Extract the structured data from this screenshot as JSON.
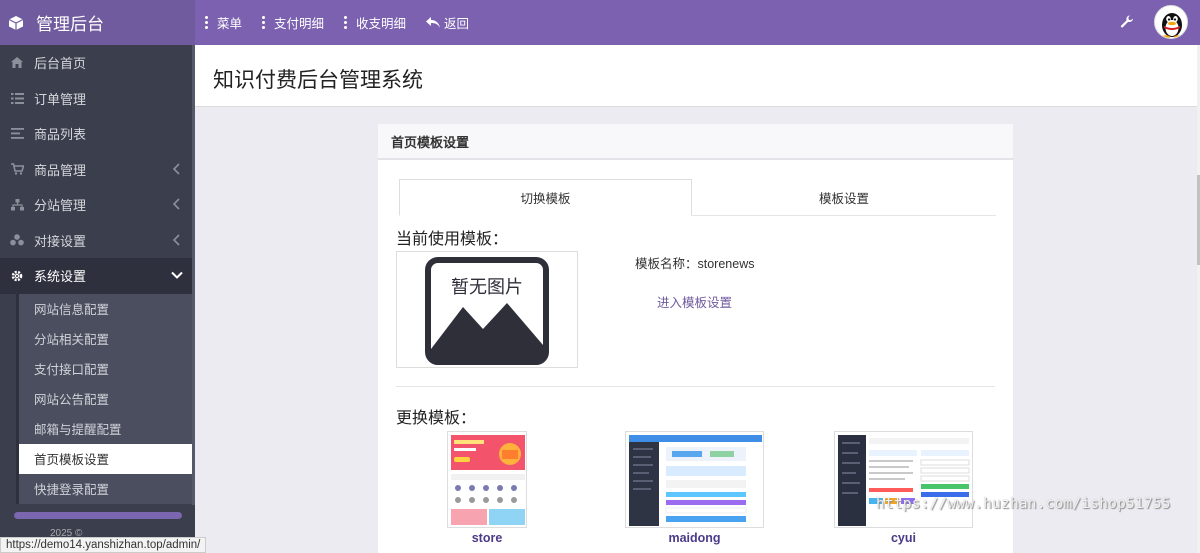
{
  "brand": {
    "title": "管理后台"
  },
  "sidebar": {
    "items": [
      {
        "label": "后台首页",
        "icon": "home-icon"
      },
      {
        "label": "订单管理",
        "icon": "list-icon"
      },
      {
        "label": "商品列表",
        "icon": "lines-icon"
      },
      {
        "label": "商品管理",
        "icon": "cart-icon"
      },
      {
        "label": "分站管理",
        "icon": "sitemap-icon"
      },
      {
        "label": "对接设置",
        "icon": "cubes-icon"
      },
      {
        "label": "系统设置",
        "icon": "gear-icon"
      }
    ],
    "sub_items": [
      {
        "label": "网站信息配置"
      },
      {
        "label": "分站相关配置"
      },
      {
        "label": "支付接口配置"
      },
      {
        "label": "网站公告配置"
      },
      {
        "label": "邮箱与提醒配置"
      },
      {
        "label": "首页模板设置"
      },
      {
        "label": "快捷登录配置"
      }
    ],
    "footer": "2025 ©"
  },
  "topbar": {
    "menu": "菜单",
    "pay_detail": "支付明细",
    "income_detail": "收支明细",
    "back": "返回"
  },
  "header": {
    "title": "知识付费后台管理系统"
  },
  "panel": {
    "title": "首页模板设置",
    "tabs": [
      {
        "label": "切换模板"
      },
      {
        "label": "模板设置"
      }
    ],
    "current_title": "当前使用模板：",
    "no_image": "暂无图片",
    "template_name": "模板名称：storenews",
    "enter_settings": "进入模板设置",
    "change_title": "更换模板：",
    "templates": [
      {
        "name": "store"
      },
      {
        "name": "maidong"
      },
      {
        "name": "cyui"
      }
    ]
  },
  "status_url": "https://demo14.yanshizhan.top/admin/",
  "watermark": "https://www.huzhan.com/ishop51755"
}
